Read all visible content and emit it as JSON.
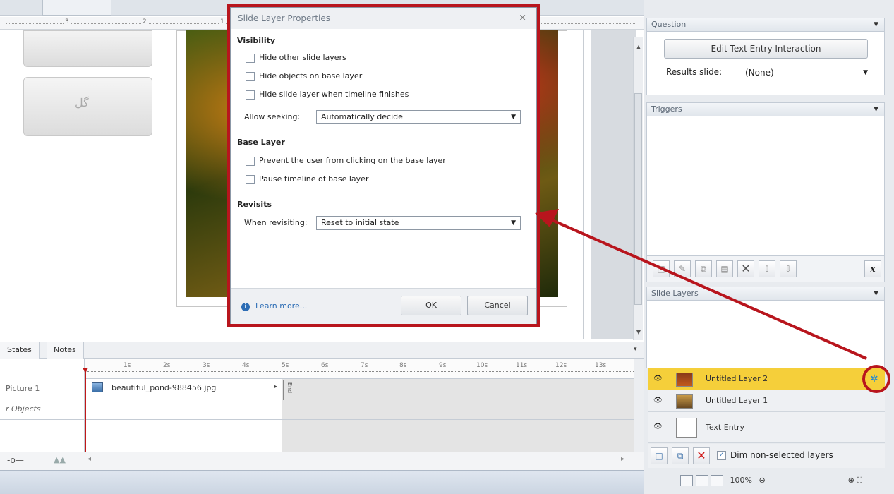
{
  "canvas": {
    "ruler_numbers": [
      "3",
      "2",
      "1"
    ],
    "arabic_button_text": "گل"
  },
  "timeline": {
    "tabs": [
      "States",
      "Notes"
    ],
    "ruler_ticks": [
      "1s",
      "2s",
      "3s",
      "4s",
      "5s",
      "6s",
      "7s",
      "8s",
      "9s",
      "10s",
      "11s",
      "12s",
      "13s"
    ],
    "rows": [
      {
        "label": "Picture 1",
        "clip": "beautiful_pond-988456.jpg"
      },
      {
        "label": "r Objects",
        "clip": ""
      }
    ],
    "end_label": "End"
  },
  "dialog": {
    "title": "Slide Layer Properties",
    "close": "×",
    "visibility_heading": "Visibility",
    "visibility_options": [
      "Hide other slide layers",
      "Hide objects on base layer",
      "Hide slide layer when timeline finishes"
    ],
    "seek_label": "Allow seeking:",
    "seek_value": "Automatically decide",
    "base_heading": "Base Layer",
    "base_options": [
      "Prevent the user from clicking on the base layer",
      "Pause timeline of base layer"
    ],
    "revisits_heading": "Revisits",
    "revisit_label": "When revisiting:",
    "revisit_value": "Reset to initial state",
    "learn_more": "Learn more...",
    "ok": "OK",
    "cancel": "Cancel"
  },
  "right_panel": {
    "question_header": "Question",
    "edit_button": "Edit Text Entry Interaction",
    "results_label": "Results slide:",
    "results_value": "(None)",
    "triggers_header": "Triggers",
    "trigger_x_label": "x",
    "slide_layers_header": "Slide Layers",
    "layers": [
      {
        "name": "Untitled Layer 2",
        "selected": true
      },
      {
        "name": "Untitled Layer 1",
        "selected": false
      },
      {
        "name": "Text Entry",
        "selected": false
      }
    ],
    "dim_label": "Dim non-selected layers",
    "zoom": "100%"
  },
  "colors": {
    "highlight_red": "#b8151d",
    "selected_layer": "#f5cf3a",
    "gear_blue": "#1e88d6"
  }
}
